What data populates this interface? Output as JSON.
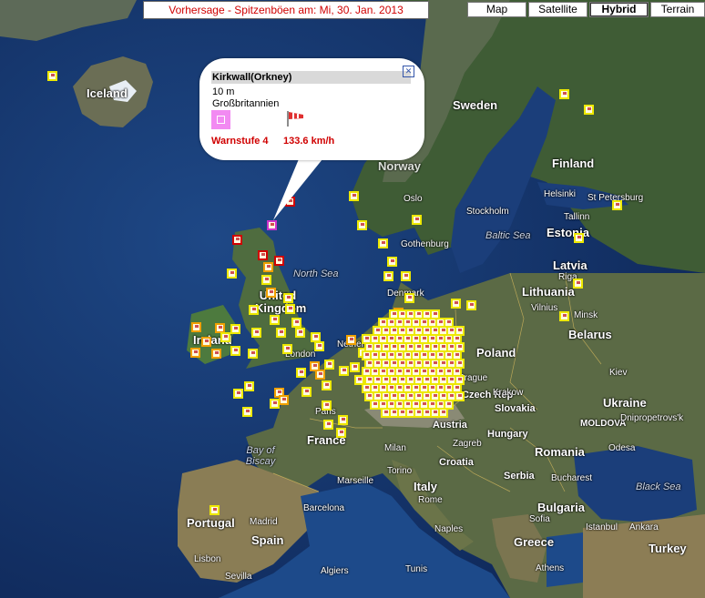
{
  "header": {
    "title": "Vorhersage - Spitzenböen am: Mi, 30. Jan. 2013"
  },
  "maptypes": [
    {
      "label": "Map",
      "active": false
    },
    {
      "label": "Satellite",
      "active": false
    },
    {
      "label": "Hybrid",
      "active": true
    },
    {
      "label": "Terrain",
      "active": false
    }
  ],
  "popup": {
    "station": "Kirkwall(Orkney)",
    "height": "10 m",
    "country": "Großbritannien",
    "warning_label": "Warnstufe 4",
    "gust": "133.6 km/h",
    "close_icon": "close-icon",
    "windsock_icon": "windsock-icon"
  },
  "places": {
    "iceland": "Iceland",
    "sweden": "Sweden",
    "finland": "Finland",
    "norway": "Norway",
    "oslo": "Oslo",
    "helsinki": "Helsinki",
    "st_petersburg": "St Petersburg",
    "stockholm": "Stockholm",
    "tallinn": "Tallinn",
    "estonia": "Estonia",
    "gothenburg": "Gothenburg",
    "baltic_sea": "Baltic Sea",
    "latvia": "Latvia",
    "riga": "Riga",
    "north_sea": "North Sea",
    "denmark": "Denmark",
    "lithuania": "Lithuania",
    "vilnius": "Vilnius",
    "minsk": "Minsk",
    "united_kingdom": "United Kingdom",
    "belarus": "Belarus",
    "ireland": "Ireland",
    "london": "London",
    "poland": "Poland",
    "netherlands": "Nether",
    "kiev": "Kiev",
    "prague": "Prague",
    "czech_rep": "Czech Rep",
    "ukraine": "Ukraine",
    "krakow": "Krakow",
    "slovakia": "Slovakia",
    "paris": "Paris",
    "moldova": "MOLDOVA",
    "dnipropetrovsk": "Dnipropetrovs'k",
    "austria": "Austria",
    "hungary": "Hungary",
    "zagreb": "Zagreb",
    "odesa": "Odesa",
    "bay_of_biscay": "Bay of Biscay",
    "france": "France",
    "milan": "Milan",
    "romania": "Romania",
    "croatia": "Croatia",
    "torino": "Torino",
    "serbia": "Serbia",
    "bucharest": "Bucharest",
    "marseille": "Marseille",
    "italy": "Italy",
    "black_sea": "Black Sea",
    "rome": "Rome",
    "barcelona": "Barcelona",
    "bulgaria": "Bulgaria",
    "sofia": "Sofia",
    "portugal": "Portugal",
    "madrid": "Madrid",
    "naples": "Naples",
    "istanbul": "Istanbul",
    "ankara": "Ankara",
    "spain": "Spain",
    "greece": "Greece",
    "turkey": "Turkey",
    "lisbon": "Lisbon",
    "sevilla": "Sevilla",
    "algiers": "Algiers",
    "tunis": "Tunis",
    "athens": "Athens"
  }
}
